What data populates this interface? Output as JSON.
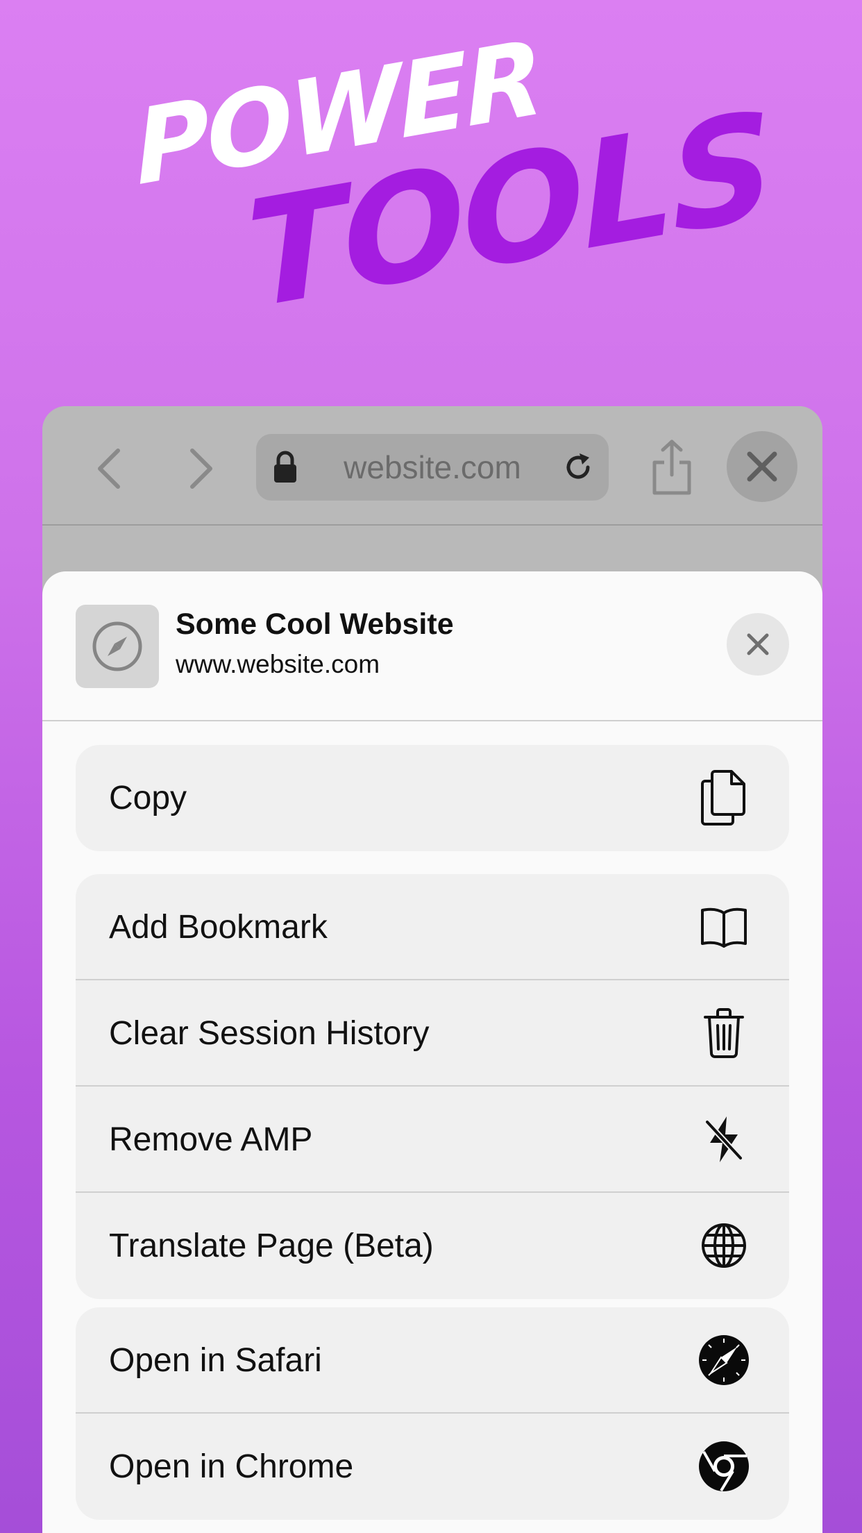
{
  "headline": {
    "line1": "POWER",
    "line2": "TOOLS"
  },
  "colors": {
    "accent": "#a41de0",
    "background_top": "#db7ff2",
    "background_bottom": "#a54ed8"
  },
  "browser": {
    "url_text": "website.com",
    "icons": {
      "back": "chevron-left-icon",
      "forward": "chevron-right-icon",
      "lock": "lock-icon",
      "reload": "reload-icon",
      "share": "share-icon",
      "close": "close-icon"
    }
  },
  "sheet": {
    "site_title": "Some Cool Website",
    "site_url": "www.website.com",
    "site_icon": "compass-icon",
    "groups": [
      {
        "items": [
          {
            "label": "Copy",
            "icon": "copy-icon"
          }
        ]
      },
      {
        "items": [
          {
            "label": "Add Bookmark",
            "icon": "book-icon"
          },
          {
            "label": "Clear Session History",
            "icon": "trash-icon"
          },
          {
            "label": "Remove AMP",
            "icon": "bolt-slash-icon"
          },
          {
            "label": "Translate Page (Beta)",
            "icon": "globe-icon"
          }
        ]
      },
      {
        "items": [
          {
            "label": "Open in Safari",
            "icon": "safari-icon"
          },
          {
            "label": "Open in Chrome",
            "icon": "chrome-icon"
          }
        ]
      }
    ]
  }
}
